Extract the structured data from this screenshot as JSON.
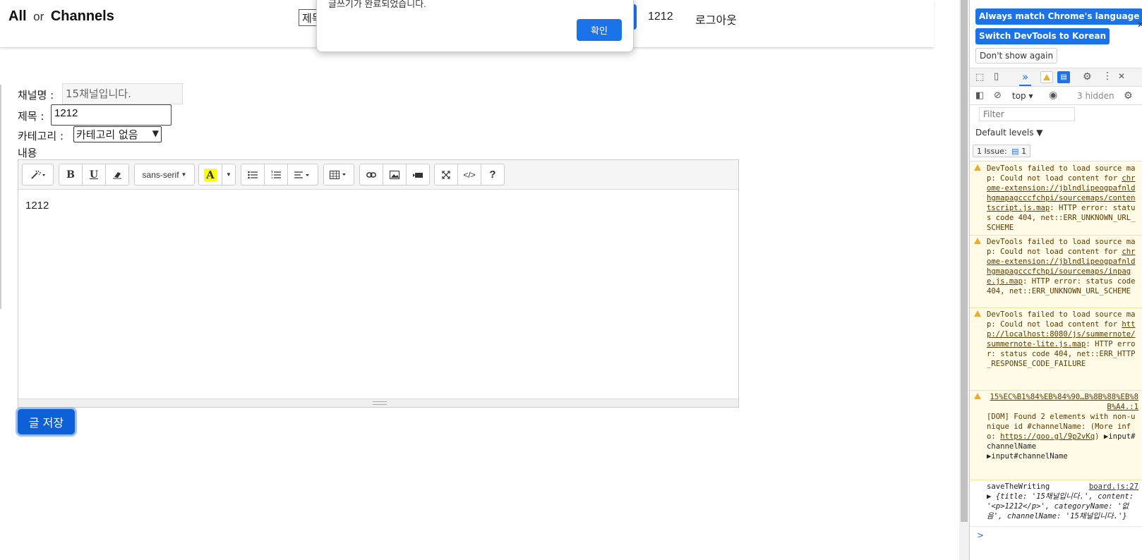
{
  "navbar": {
    "brand_all": "All",
    "brand_or": "or",
    "brand_channels": "Channels",
    "search_value": "제목",
    "username": "1212",
    "logout": "로그아웃"
  },
  "alert": {
    "message": "글쓰기가 완료되었습니다.",
    "ok_label": "확인"
  },
  "form": {
    "channel_label": "채널명 :",
    "channel_value": "15채널입니다.",
    "title_label": "제목 :",
    "title_value": "1212",
    "category_label": "카테고리 :",
    "category_value": "카테고리 없음",
    "content_label": "내용",
    "save_label": "글 저장"
  },
  "editor": {
    "font_name": "sans-serif",
    "content": "1212",
    "tools": [
      "magic-icon",
      "bold-icon",
      "underline-icon",
      "eraser-icon",
      "font-family-dropdown",
      "text-color-icon",
      "color-dropdown-icon",
      "unordered-list-icon",
      "ordered-list-icon",
      "paragraph-align-icon",
      "table-icon",
      "link-icon",
      "picture-icon",
      "video-icon",
      "fullscreen-icon",
      "codeview-icon",
      "help-icon"
    ]
  },
  "devtools": {
    "lang_match": "Always match Chrome's language",
    "lang_switch": "Switch DevTools to Korean",
    "dont_show": "Don't show again",
    "context": "top",
    "hidden": "3 hidden",
    "filter_placeholder": "Filter",
    "levels": "Default levels ▼",
    "issues_label": "1 Issue:",
    "issues_count": "1",
    "warnings": [
      {
        "pre": "DevTools failed to load source map: Could not load content for ",
        "link": "chrome-extension://jblndlipeogpafnldhgmapagcccfchpi/sourcemaps/contentscript.js.map",
        "post": ": HTTP error: status code 404, net::ERR_UNKNOWN_URL_SCHEME"
      },
      {
        "pre": "DevTools failed to load source map: Could not load content for ",
        "link": "chrome-extension://jblndlipeogpafnldhgmapagcccfchpi/sourcemaps/inpage.js.map",
        "post": ": HTTP error: status code 404, net::ERR_UNKNOWN_URL_SCHEME"
      },
      {
        "pre": "DevTools failed to load source map: Could not load content for ",
        "link": "http://localhost:8080/js/summernote/summernote-lite.js.map",
        "post": ": HTTP error: status code 404, net::ERR_HTTP_RESPONSE_CODE_FAILURE"
      }
    ],
    "dom_warning": {
      "source": "15%EC%B1%84%EB%84%90…B%8B%88%EB%8B%A4.:1",
      "text": "[DOM] Found 2 elements with non-unique id #channelName: (More info: ",
      "link": "https://goo.gl/9p2vKq",
      "after": ")",
      "node1": "▶input#channelName",
      "node2": "▶input#channelName"
    },
    "log": {
      "label": "saveTheWriting",
      "source": "board.js:27",
      "object": "▶ {title: '15채널입니다.', content: '<p>1212</p>', categoryName: '없음', channelName: '15채널입니다.'}"
    },
    "prompt": ">"
  },
  "colors": {
    "primary": "#1a73e8",
    "save_button": "#0d60d8",
    "warning_bg": "#fffbe6"
  }
}
